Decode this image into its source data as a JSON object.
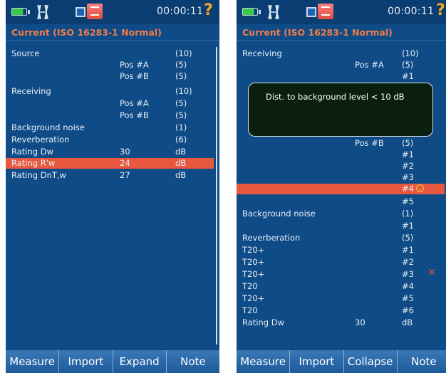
{
  "left": {
    "status": {
      "time": "00:00:11",
      "help": "?"
    },
    "title": "Current (ISO 16283-1 Normal)",
    "rows": [
      {
        "label": "Source",
        "mid": "",
        "value": "(10)",
        "unit": ""
      },
      {
        "label": "",
        "mid": "Pos #A",
        "value": "(5)",
        "unit": ""
      },
      {
        "label": "",
        "mid": "Pos #B",
        "value": "(5)",
        "unit": ""
      },
      {
        "label": "Receiving",
        "mid": "",
        "value": "(10)",
        "unit": ""
      },
      {
        "label": "",
        "mid": "Pos #A",
        "value": "(5)",
        "unit": ""
      },
      {
        "label": "",
        "mid": "Pos #B",
        "value": "(5)",
        "unit": ""
      },
      {
        "label": "Background noise",
        "mid": "",
        "value": "(1)",
        "unit": ""
      },
      {
        "label": "Reverberation",
        "mid": "",
        "value": "(6)",
        "unit": ""
      },
      {
        "label": "Rating  Dw",
        "mid": "30",
        "value": "",
        "unit": "dB"
      },
      {
        "label": "Rating  R'w",
        "mid": "24",
        "value": "",
        "unit": "dB"
      },
      {
        "label": "Rating  DnT,w",
        "mid": "27",
        "value": "",
        "unit": "dB"
      }
    ],
    "softkeys": [
      "Measure",
      "Import",
      "Expand",
      "Note"
    ]
  },
  "right": {
    "status": {
      "time": "00:00:11",
      "help": "?"
    },
    "title": "Current (ISO 16283-1 Normal)",
    "tooltip": "Dist. to background level < 10 dB",
    "rows": [
      {
        "label": "Receiving",
        "mid": "",
        "value": "(10)"
      },
      {
        "label": "",
        "mid": "Pos #A",
        "value": "(5)"
      },
      {
        "label": "",
        "mid": "",
        "value": "#1"
      },
      {
        "label": "",
        "mid": "Pos #B",
        "value": "(5)"
      },
      {
        "label": "",
        "mid": "",
        "value": "#1"
      },
      {
        "label": "",
        "mid": "",
        "value": "#2"
      },
      {
        "label": "",
        "mid": "",
        "value": "#3"
      },
      {
        "label": "",
        "mid": "",
        "value": "#4"
      },
      {
        "label": "",
        "mid": "",
        "value": "#5"
      },
      {
        "label": "Background noise",
        "mid": "",
        "value": "(1)"
      },
      {
        "label": "",
        "mid": "",
        "value": "#1"
      },
      {
        "label": "Reverberation",
        "mid": "",
        "value": "(5)"
      },
      {
        "label": " T20+",
        "mid": "",
        "value": "#1"
      },
      {
        "label": " T20+",
        "mid": "",
        "value": "#2"
      },
      {
        "label": " T20+",
        "mid": "",
        "value": "#3"
      },
      {
        "label": " T20",
        "mid": "",
        "value": "#4"
      },
      {
        "label": " T20+",
        "mid": "",
        "value": "#5"
      },
      {
        "label": " T20",
        "mid": "",
        "value": "#6"
      },
      {
        "label": "Rating  Dw",
        "mid": "30",
        "value": "dB"
      }
    ],
    "softkeys": [
      "Measure",
      "Import",
      "Collapse",
      "Note"
    ]
  },
  "colors": {
    "background": "#0f4b86",
    "highlight": "#e8583e",
    "title": "#f07c4a",
    "help": "#f5a623"
  }
}
